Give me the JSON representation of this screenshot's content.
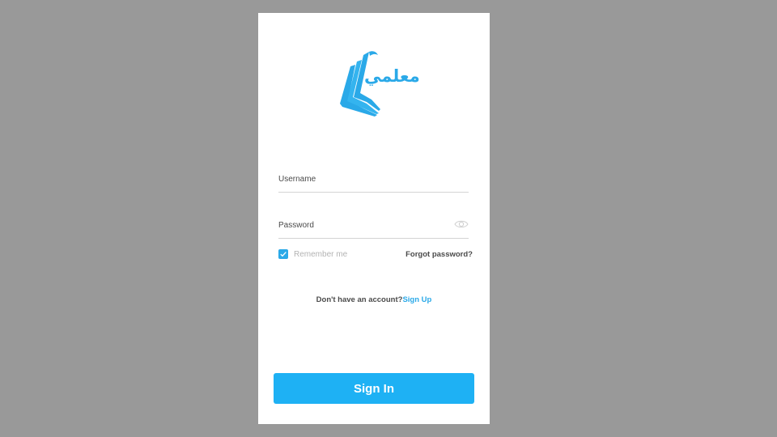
{
  "brand": {
    "logo_text": "معلمي",
    "logo_icon": "open-book-icon",
    "accent_color": "#2aa9e8"
  },
  "form": {
    "username_placeholder": "Username",
    "username_value": "",
    "password_placeholder": "Password",
    "password_value": "",
    "password_toggle_icon": "eye-icon",
    "remember_label": "Remember me",
    "remember_checked": true,
    "forgot_label": "Forgot password?",
    "signup_prompt": "Don't have an account?",
    "signup_link": "Sign Up",
    "signin_label": "Sign In",
    "signin_color": "#1eb1f4"
  }
}
